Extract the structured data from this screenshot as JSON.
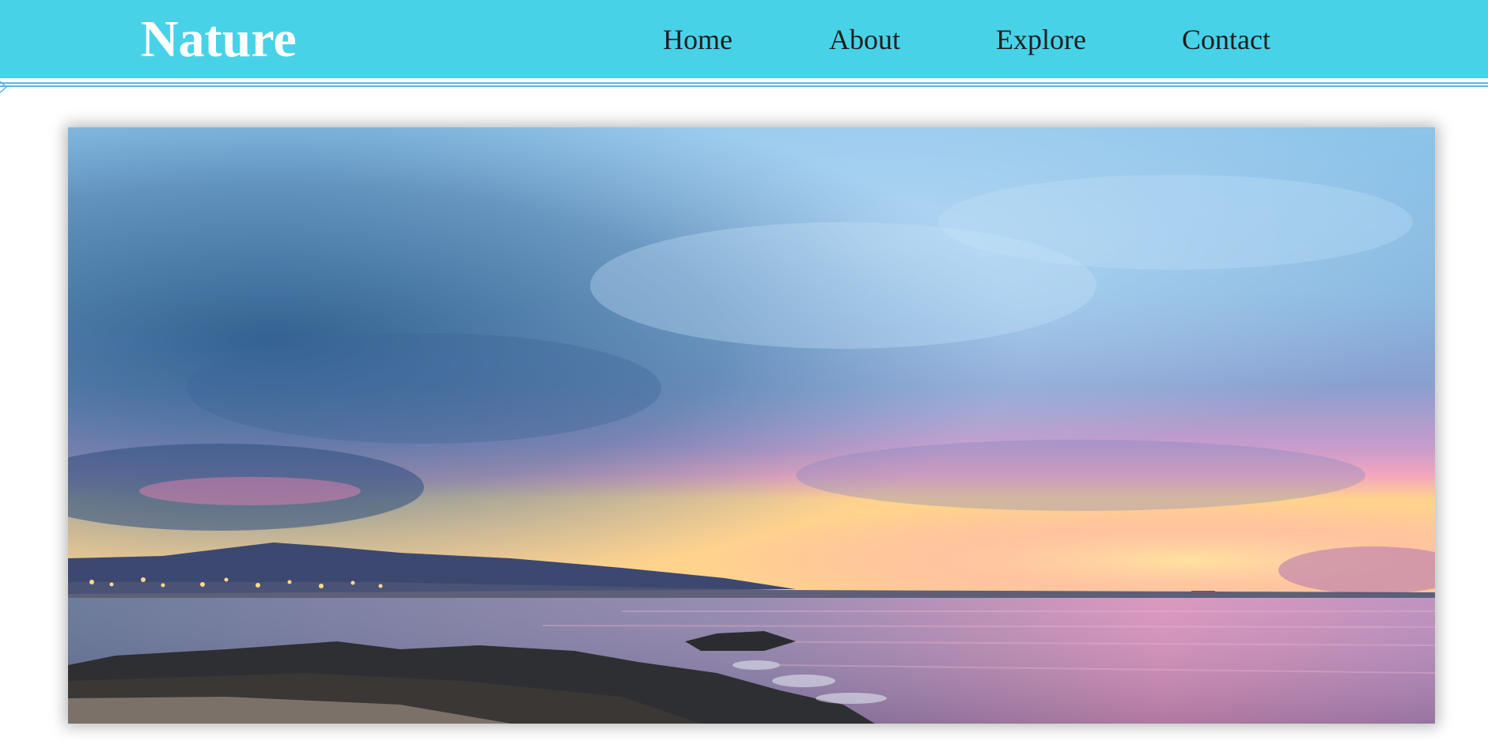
{
  "header": {
    "logo": "Nature",
    "background_color": "#48d2e8",
    "accent_line_color": "#5ab4ea",
    "nav": [
      {
        "label": "Home"
      },
      {
        "label": "About"
      },
      {
        "label": "Explore"
      },
      {
        "label": "Contact"
      }
    ]
  },
  "hero": {
    "image_subject": "sunset-over-sea-landscape-image",
    "colors": {
      "sky_top": "#7fb5de",
      "sky_dark": "#3a6f9c",
      "sunset_pink": "#e58fbf",
      "sunset_orange": "#ffd08a",
      "sea": "#6f6f99",
      "rocks": "#2e2f33"
    }
  }
}
